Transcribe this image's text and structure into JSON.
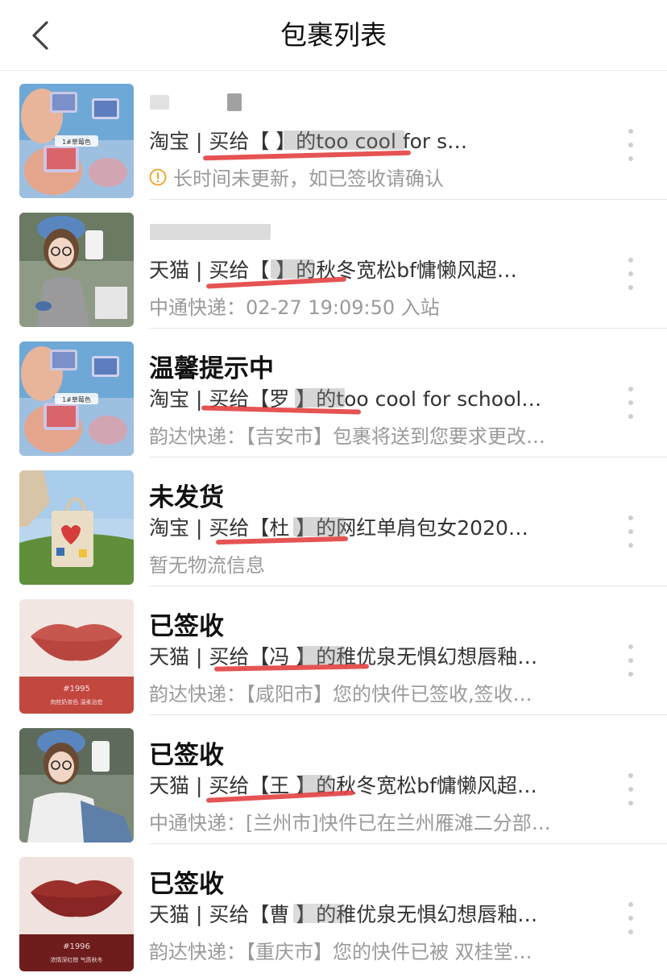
{
  "nav": {
    "title": "包裹列表"
  },
  "packages": [
    {
      "status": "",
      "desc": "淘宝 | 买给【                    】的too cool for s…",
      "track": "长时间未更新，如已签收请确认",
      "track_icon": "info-icon"
    },
    {
      "status": "",
      "desc": "天猫 | 买给【     】的秋冬宽松bf慵懒风超…",
      "track": "中通快递：02-27 19:09:50 入站",
      "track_icon": ""
    },
    {
      "status": "温馨提示中",
      "desc": "淘宝 | 买给【罗      】的too cool for school…",
      "track": "韵达快递：【吉安市】包裹将送到您要求更改…",
      "track_icon": ""
    },
    {
      "status": "未发货",
      "desc": "淘宝 | 买给【杜       】的网红单肩包女2020…",
      "track": "暂无物流信息",
      "track_icon": ""
    },
    {
      "status": "已签收",
      "desc": "天猫 | 买给【冯       】的稚优泉无惧幻想唇釉…",
      "track": "韵达快递：【咸阳市】您的快件已签收,签收…",
      "track_icon": ""
    },
    {
      "status": "已签收",
      "desc": "天猫 | 买给【王    】的秋冬宽松bf慵懒风超…",
      "track": "中通快递：[兰州市]快件已在兰州雁滩二分部…",
      "track_icon": ""
    },
    {
      "status": "已签收",
      "desc": "天猫 | 买给【曹        】的稚优泉无惧幻想唇釉…",
      "track": "韵达快递：【重庆市】您的快件已被 双桂堂…",
      "track_icon": ""
    }
  ],
  "thumb_text": {
    "blush_label": "1#草莓色",
    "lip1_code": "#1995",
    "lip1_name": "肉桂奶茶色 温柔治愈",
    "lip2_code": "#1996",
    "lip2_name": "浓情深红棕 气质秋冬"
  },
  "colors": {
    "annotation": "#e23b3b",
    "warning": "#f0a020",
    "muted_text": "#9a9a9a"
  }
}
